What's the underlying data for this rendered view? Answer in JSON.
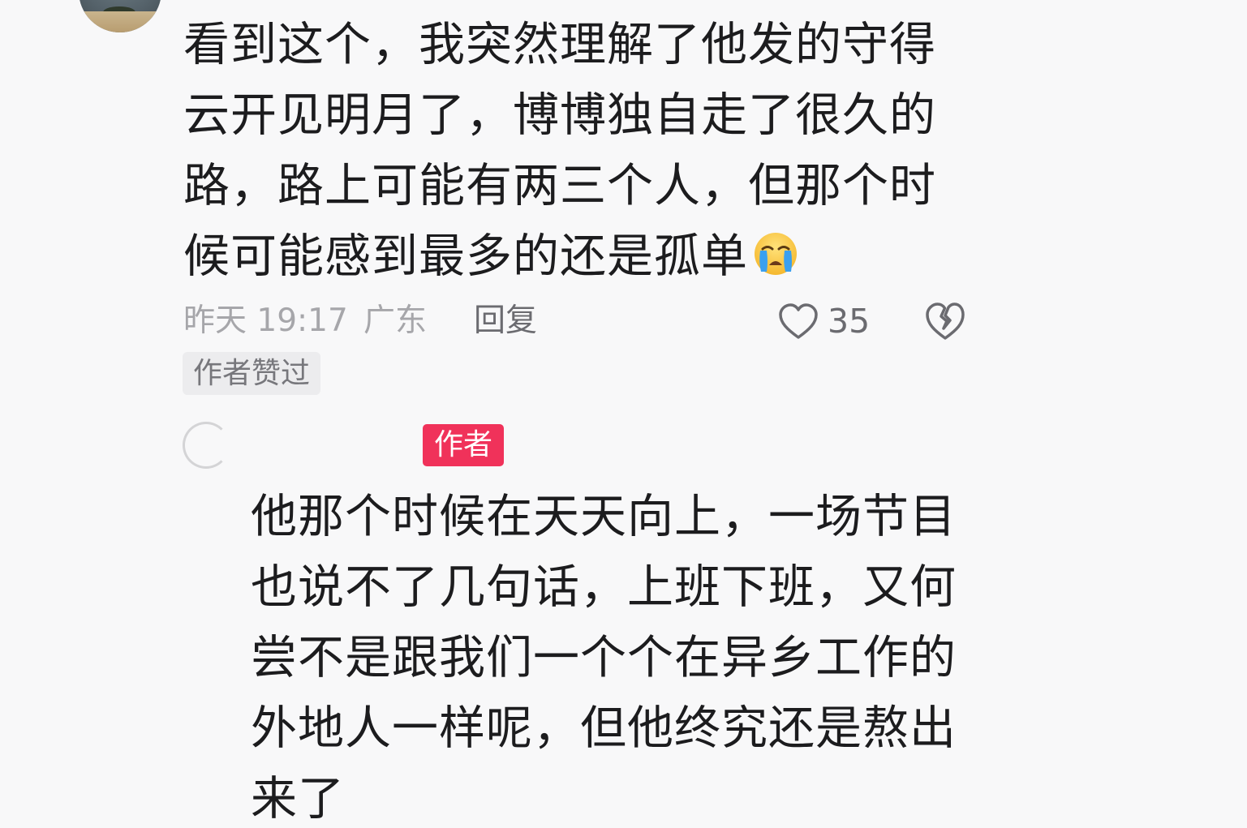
{
  "comment": {
    "text": "看到这个，我突然理解了他发的守得云开见明月了，博博独自走了很久的路，路上可能有两三个人，但那个时候可能感到最多的还是孤单",
    "emoji": "loudly-crying-face",
    "time": "昨天 19:17",
    "region": "广东",
    "reply_label": "回复",
    "like_count": "35",
    "liked_by_author_badge": "作者赞过"
  },
  "reply": {
    "username": "",
    "author_badge": "作者",
    "text": "他那个时候在天天向上，一场节目也说不了几句话，上班下班，又何尝不是跟我们一个个在异乡工作的外地人一样呢，但他终究还是熬出来了"
  },
  "colors": {
    "background": "#f8f8f9",
    "text": "#1c1c1e",
    "meta_gray": "#a6a6aa",
    "author_badge_red": "#f0325a"
  }
}
